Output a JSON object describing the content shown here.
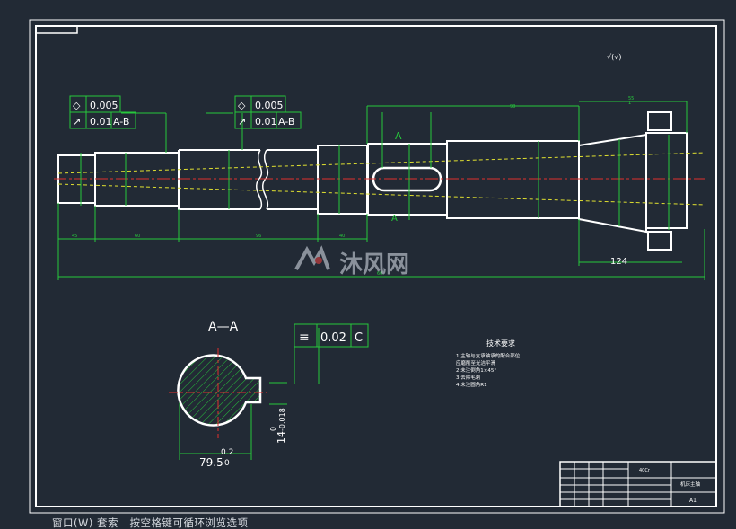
{
  "drawing": {
    "roughness_symbol": "√(√)",
    "tolerance_frame_1": {
      "symbol": "◇",
      "value_row1": "0.005",
      "symbol2": "↗",
      "value_row2": "0.01",
      "datum": "A-B"
    },
    "tolerance_frame_2": {
      "symbol": "◇",
      "value_row1": "0.005",
      "symbol2": "↗",
      "value_row2": "0.01",
      "datum": "A-B"
    },
    "section_marker_top": "A",
    "section_marker_bottom": "A",
    "dimension_124": "124",
    "section_title": "A—A",
    "section_tolerance": {
      "symbol": "≡",
      "value": "0.02",
      "datum": "C"
    },
    "section_dim_width": "79.5",
    "section_dim_width_tol": "0.2",
    "section_dim_width_tol2": "0",
    "section_dim_height": "14",
    "section_dim_height_tol1": "0",
    "section_dim_height_tol2": "-0.018",
    "tech_req_title": "技术要求",
    "tech_req_items": [
      "1.主轴与支承轴承的配合部位",
      "  应磨削至光洁平滑",
      "2.未注倒角1×45°",
      "3.去除毛刺",
      "4.未注圆角R1"
    ],
    "title_block_part_name": "机床主轴",
    "title_block_sheet": "A1",
    "title_block_material": "40Cr"
  },
  "watermark": {
    "brand_text": "沐风网"
  },
  "statusbar": {
    "text": "窗口(W) 套索   按空格键可循环浏览选项"
  },
  "colors": {
    "background": "#222a35",
    "outline": "#ffffff",
    "dimension": "#27c83c",
    "centerline": "#e0302d",
    "hatch": "#e0e030",
    "text": "#ffffff"
  }
}
